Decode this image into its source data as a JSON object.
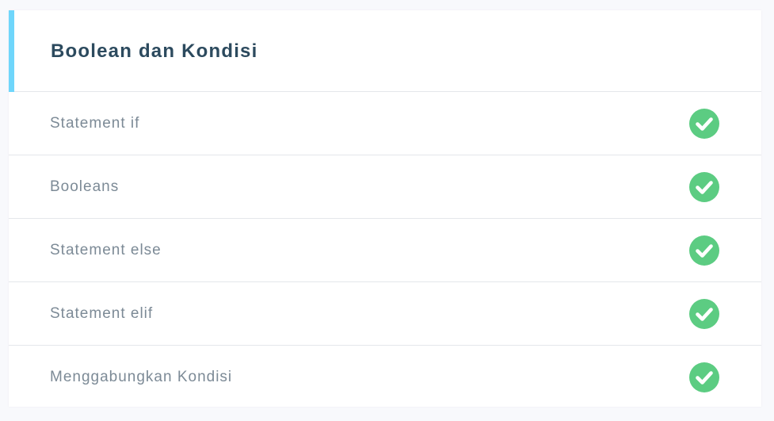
{
  "section": {
    "title": "Boolean dan Kondisi",
    "accent_color": "#6fd6fb"
  },
  "lessons": [
    {
      "label": "Statement if",
      "status": "completed",
      "icon": "check-circle-icon"
    },
    {
      "label": "Booleans",
      "status": "completed",
      "icon": "check-circle-icon"
    },
    {
      "label": "Statement else",
      "status": "completed",
      "icon": "check-circle-icon"
    },
    {
      "label": "Statement elif",
      "status": "completed",
      "icon": "check-circle-icon"
    },
    {
      "label": "Menggabungkan Kondisi",
      "status": "completed",
      "icon": "check-circle-icon"
    }
  ],
  "colors": {
    "check": "#5ccc82",
    "title": "#2c4a5e",
    "label": "#7c8a96"
  }
}
